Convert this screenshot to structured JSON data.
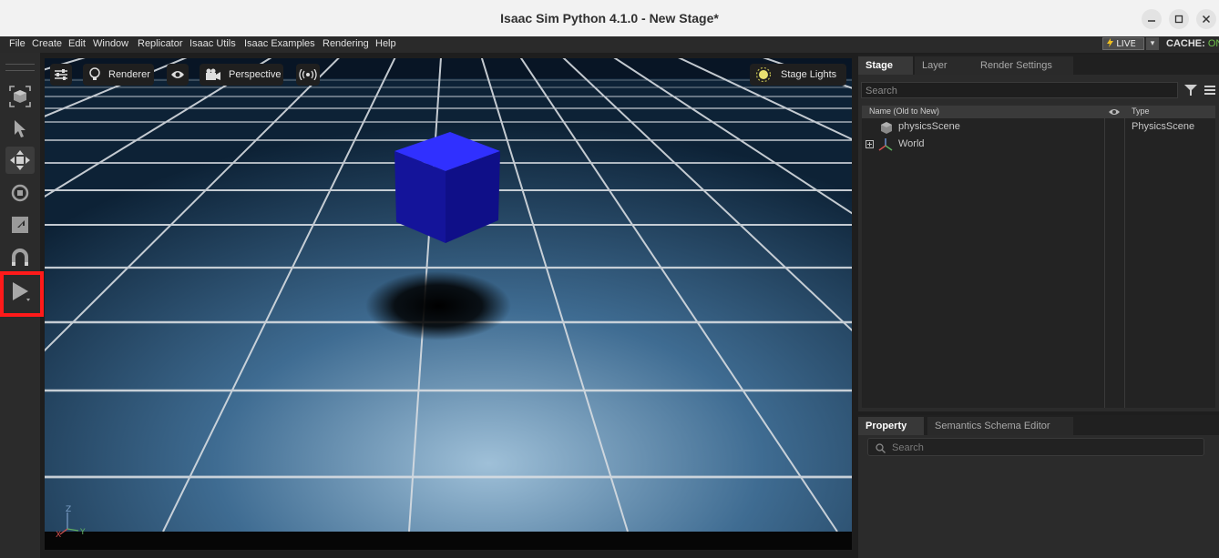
{
  "window": {
    "title": "Isaac Sim Python 4.1.0 - New Stage*"
  },
  "menu": [
    "File",
    "Create",
    "Edit",
    "Window",
    "Replicator",
    "Isaac Utils",
    "Isaac Examples",
    "Rendering",
    "Help"
  ],
  "status": {
    "live_label": "LIVE",
    "cache_label": "CACHE:",
    "cache_value": "ON"
  },
  "viewport": {
    "renderer_label": "Renderer",
    "camera_label": "Perspective",
    "lights_label": "Stage Lights",
    "axis_z": "Z",
    "axis_x": "X",
    "axis_y": "Y"
  },
  "stage": {
    "tabs": [
      "Stage",
      "Layer",
      "Render Settings"
    ],
    "search_placeholder": "Search",
    "col_name": "Name (Old to New)",
    "col_type": "Type",
    "items": [
      {
        "name": "physicsScene",
        "type": "PhysicsScene"
      },
      {
        "name": "World",
        "type": ""
      }
    ]
  },
  "property": {
    "tabs": [
      "Property",
      "Semantics Schema Editor"
    ],
    "search_placeholder": "Search"
  },
  "colors": {
    "highlight": "#ff1a1a",
    "accent_green": "#6cc04a",
    "cube": "#1a1ae0"
  }
}
